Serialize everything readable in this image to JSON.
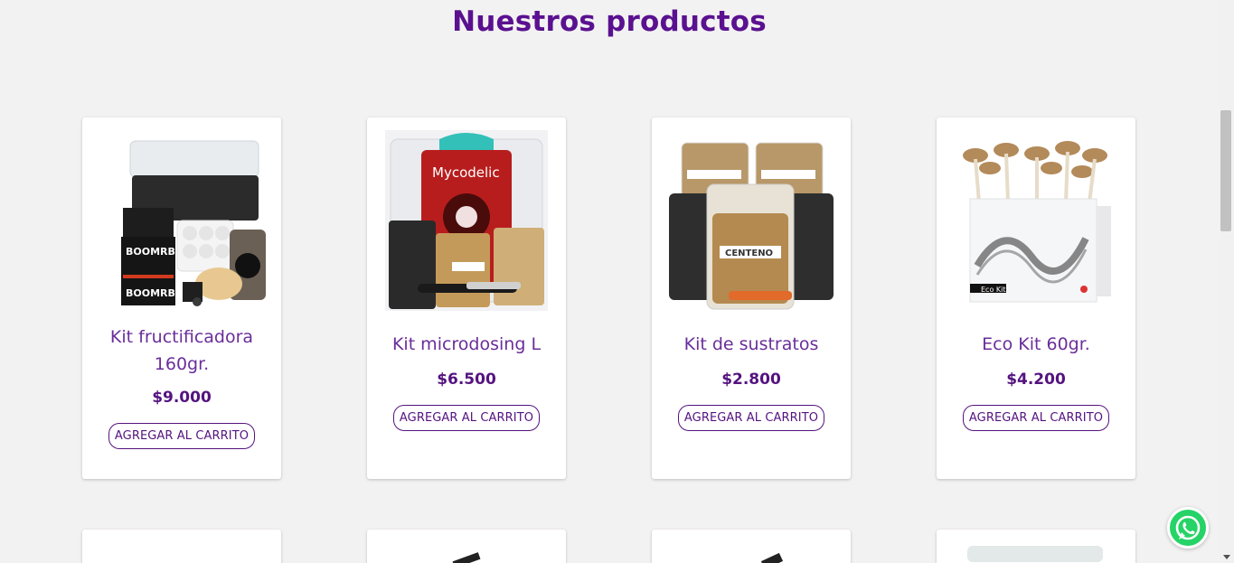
{
  "page": {
    "title": "Nuestros productos"
  },
  "products": [
    {
      "name": "Kit fructificadora 160gr.",
      "price": "$9.000",
      "button": "AGREGAR AL CARRITO",
      "image_icon": "fruiting-kit-image"
    },
    {
      "name": "Kit microdosing L",
      "price": "$6.500",
      "button": "AGREGAR AL CARRITO",
      "image_icon": "microdosing-kit-image"
    },
    {
      "name": "Kit de sustratos",
      "price": "$2.800",
      "button": "AGREGAR AL CARRITO",
      "image_icon": "substrate-kit-image"
    },
    {
      "name": "Eco Kit 60gr.",
      "price": "$4.200",
      "button": "AGREGAR AL CARRITO",
      "image_icon": "eco-kit-image"
    }
  ],
  "image_text": {
    "boombag": "BOOMRBAG",
    "mycodelic": "Mycodelic",
    "centeno": "CENTENO",
    "eco_kit": "Eco Kit"
  },
  "colors": {
    "accent": "#5a1190",
    "whatsapp": "#25d366",
    "background": "#f3f2f2"
  }
}
